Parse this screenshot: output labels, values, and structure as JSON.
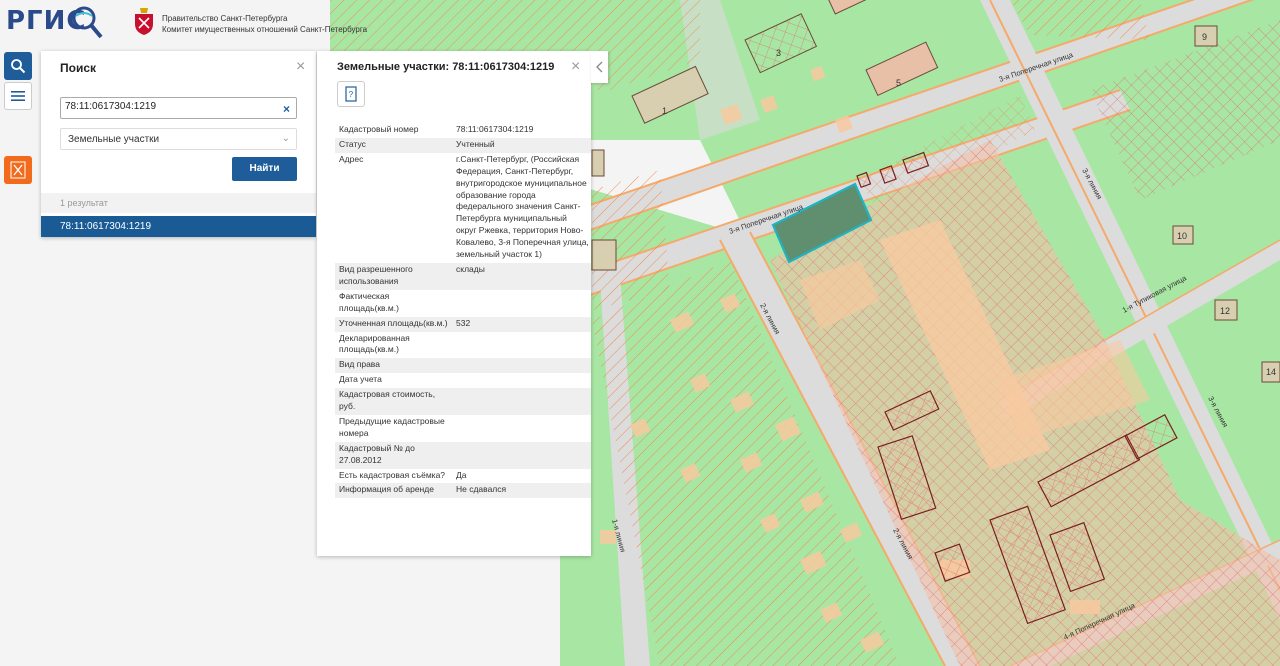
{
  "header": {
    "logo_text": "РГИС",
    "gov_line1": "Правительство Санкт-Петербурга",
    "gov_line2": "Комитет имущественных отношений Санкт-Петербурга"
  },
  "sidebar": {
    "search_icon": "search-icon",
    "menu_icon": "hamburger-menu-icon",
    "layer_icon": "spb-emblem-icon"
  },
  "search": {
    "title": "Поиск",
    "query": "78:11:0617304:1219",
    "category": "Земельные участки",
    "find_label": "Найти",
    "results_count": "1 результат",
    "results": [
      "78:11:0617304:1219"
    ]
  },
  "info": {
    "title": "Земельные участки: 78:11:0617304:1219",
    "rows": [
      {
        "key": "Кадастровый номер",
        "value": "78:11:0617304:1219"
      },
      {
        "key": "Статус",
        "value": "Учтенный"
      },
      {
        "key": "Адрес",
        "value": "г.Санкт-Петербург, (Российская Федерация, Санкт-Петербург, внутригородское муниципальное образование города федерального значения Санкт-Петербурга муниципальный округ Ржевка, территория Ново-Ковалево, 3-я Поперечная улица, земельный участок 1)"
      },
      {
        "key": "Вид разрешенного использования",
        "value": "склады"
      },
      {
        "key": "Фактическая площадь(кв.м.)",
        "value": ""
      },
      {
        "key": "Уточненная площадь(кв.м.)",
        "value": "532"
      },
      {
        "key": "Декларированная площадь(кв.м.)",
        "value": ""
      },
      {
        "key": "Вид права",
        "value": ""
      },
      {
        "key": "Дата учета",
        "value": ""
      },
      {
        "key": "Кадастровая стоимость, руб.",
        "value": ""
      },
      {
        "key": "Предыдущие кадастровые номера",
        "value": ""
      },
      {
        "key": "Кадастровый № до 27.08.2012",
        "value": ""
      },
      {
        "key": "Есть кадастровая съёмка?",
        "value": "Да"
      },
      {
        "key": "Информация об аренде",
        "value": "Не сдавался"
      }
    ]
  },
  "map": {
    "streets": [
      "3-я Поперечная улица",
      "3-я Поперечная улица",
      "3-я линия",
      "2-я линия",
      "2-я линия",
      "1-я линия",
      "1-я Тупиковая улица",
      "3-я линия",
      "4-я Поперечная улица"
    ],
    "building_numbers": [
      "1",
      "3",
      "5",
      "9",
      "10",
      "12",
      "14"
    ],
    "colors": {
      "green": "#a8e6a3",
      "light_green": "#c7efc4",
      "road": "#d9d9d9",
      "road_edge": "#f5a96a",
      "hatch_orange": "#f08a4a",
      "parcel_pink": "#e8a0a0",
      "selected_parcel": "#5f8f6e",
      "selected_outline": "#1fb3c4",
      "accent_blue": "#1e5d99",
      "layer_button": "#f26b1d"
    }
  }
}
